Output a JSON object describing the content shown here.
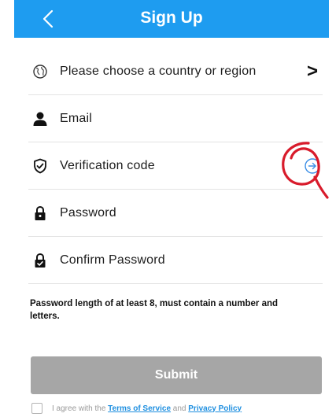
{
  "header": {
    "title": "Sign Up",
    "back_icon": "chevron-left-icon",
    "background": "#1e9cf0"
  },
  "form": {
    "country": {
      "label": "Please choose a country or region",
      "icon": "globe-icon",
      "chevron": ">"
    },
    "email": {
      "placeholder": "Email",
      "icon": "user-icon"
    },
    "verification": {
      "placeholder": "Verification code",
      "icon": "shield-check-icon",
      "action_icon": "arrow-right-circle-icon"
    },
    "password": {
      "placeholder": "Password",
      "icon": "lock-icon"
    },
    "confirm_password": {
      "placeholder": "Confirm Password",
      "icon": "lock-check-icon"
    }
  },
  "hint": "Password length of at least 8, must contain a number and letters.",
  "submit": {
    "label": "Submit",
    "color": "#a6a6a6"
  },
  "agreement": {
    "prefix": "I agree with the",
    "terms": "Terms of Service",
    "and": "and",
    "privacy": "Privacy Policy"
  },
  "annotation": {
    "type": "red-circle",
    "color": "#d81b2b"
  }
}
